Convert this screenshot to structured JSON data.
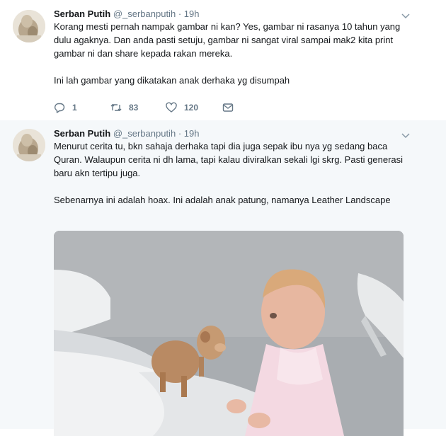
{
  "tweets": [
    {
      "author": {
        "name": "Serban Putih",
        "handle": "@_serbanputih",
        "separator": "·",
        "time": "19h"
      },
      "paragraphs": [
        "Korang mesti pernah nampak gambar ni kan? Yes, gambar ni rasanya 10 tahun yang dulu agaknya. Dan anda pasti setuju, gambar ni sangat viral sampai mak2 kita print gambar ni dan share kepada rakan mereka.",
        "Ini lah gambar yang dikatakan anak derhaka yg disumpah"
      ],
      "actions": {
        "reply_count": "1",
        "retweet_count": "83",
        "like_count": "120"
      },
      "icons": {
        "reply": "reply-icon",
        "retweet": "retweet-icon",
        "like": "heart-icon",
        "dm": "envelope-icon",
        "menu": "chevron-down-icon"
      }
    },
    {
      "author": {
        "name": "Serban Putih",
        "handle": "@_serbanputih",
        "separator": "·",
        "time": "19h"
      },
      "paragraphs": [
        "Menurut cerita tu, bkn sahaja derhaka tapi dia juga sepak ibu nya yg sedang baca Quran. Walaupun cerita ni dh lama, tapi kalau diviralkan sekali lgi skrg. Pasti generasi baru akn tertipu juga.",
        "Sebenarnya ini adalah hoax. Ini adalah anak patung, namanya Leather Landscape"
      ],
      "icons": {
        "menu": "chevron-down-icon"
      }
    }
  ],
  "colors": {
    "thread_line": "#c3e3c3",
    "secondary_text": "#657786",
    "primary_text": "#14171a",
    "reply_bg": "#f5f8fa"
  }
}
